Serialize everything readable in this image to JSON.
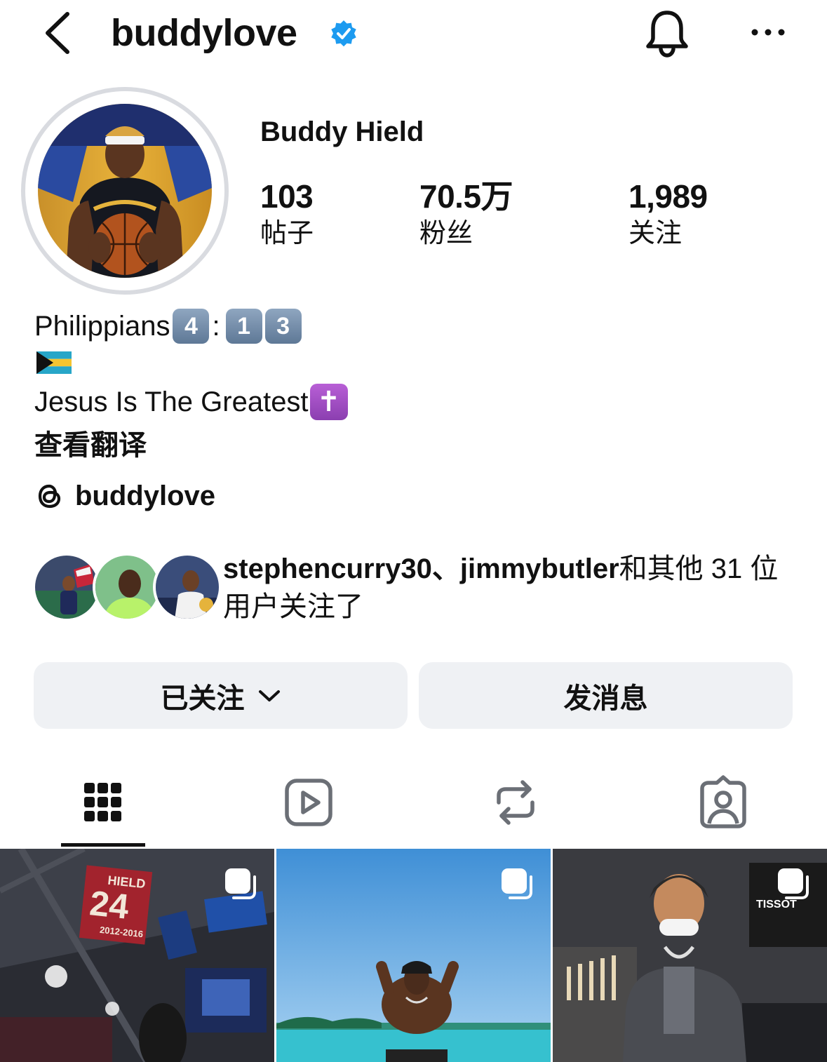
{
  "header": {
    "username": "buddylove",
    "back_icon": "chevron-left-icon",
    "verified_icon": "verified-badge-icon",
    "bell_icon": "bell-icon",
    "more_icon": "more-horizontal-icon",
    "verified_color": "#1d9bf0"
  },
  "profile": {
    "full_name": "Buddy Hield",
    "stats": {
      "posts": {
        "value": "103",
        "label": "帖子"
      },
      "followers": {
        "value": "70.5万",
        "label": "粉丝"
      },
      "following": {
        "value": "1,989",
        "label": "关注"
      }
    },
    "bio": {
      "line1_text": "Philippians",
      "line1_keycaps": [
        "4",
        "1",
        "3"
      ],
      "line1_colon": ":",
      "flag_icon": "bahamas-flag-icon",
      "line3_text": "Jesus Is The Greatest",
      "cross_icon": "latin-cross-icon",
      "cross_glyph": "✝",
      "translate_label": "查看翻译"
    },
    "threads": {
      "icon": "threads-icon",
      "handle": "buddylove"
    }
  },
  "mutual": {
    "names": "stephencurry30、jimmybutler",
    "rest": "和其他 31 位用户关注了"
  },
  "actions": {
    "following_label": "已关注",
    "message_label": "发消息",
    "button_bg": "#eff1f4"
  },
  "tabs": {
    "items": [
      {
        "name": "grid",
        "icon": "grid-icon",
        "active": true
      },
      {
        "name": "reels",
        "icon": "reels-icon",
        "active": false
      },
      {
        "name": "reposts",
        "icon": "repost-icon",
        "active": false
      },
      {
        "name": "tagged",
        "icon": "tagged-person-icon",
        "active": false
      }
    ]
  },
  "grid": {
    "posts": [
      {
        "kind": "carousel",
        "overlay_icon": "carousel-icon",
        "banner_name": "HIELD",
        "banner_number": "24",
        "banner_years": "2012-2016"
      },
      {
        "kind": "carousel",
        "overlay_icon": "carousel-icon"
      },
      {
        "kind": "carousel",
        "overlay_icon": "carousel-icon",
        "sign_text": "TISSOT"
      }
    ]
  }
}
